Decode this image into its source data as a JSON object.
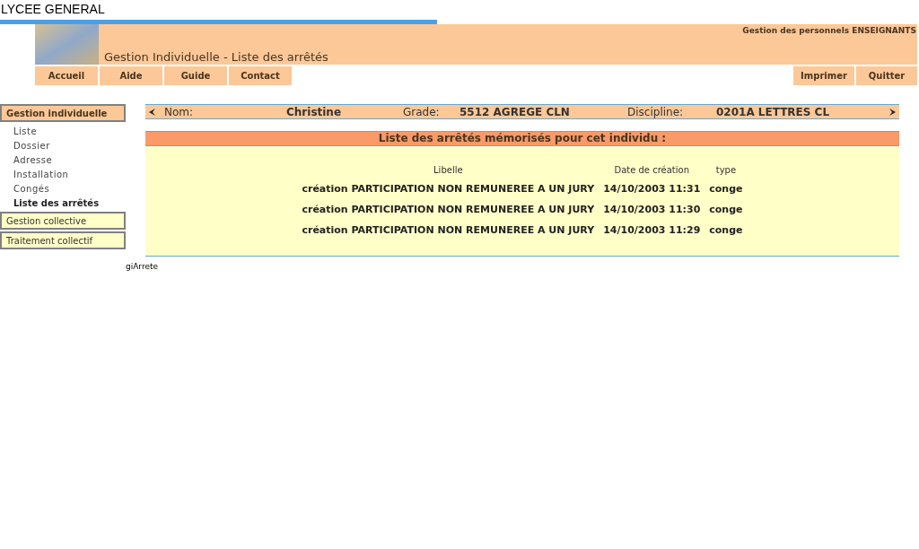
{
  "site_title": "LYCEE GENERAL",
  "banner": {
    "subtitle": "Gestion des personnels ENSEIGNANTS",
    "title": "Gestion Individuelle - Liste des arrêtés"
  },
  "nav_left": [
    "Accueil",
    "Aide",
    "Guide",
    "Contact"
  ],
  "nav_right": [
    "Imprimer",
    "Quitter"
  ],
  "sidebar": [
    {
      "label": "Gestion individuelle",
      "selected": true,
      "children": [
        {
          "label": "Liste",
          "selected": false
        },
        {
          "label": "Dossier",
          "selected": false
        },
        {
          "label": "Adresse",
          "selected": false
        },
        {
          "label": "Installation",
          "selected": false
        },
        {
          "label": "Congés",
          "selected": false
        },
        {
          "label": "Liste des arrêtés",
          "selected": true
        }
      ]
    },
    {
      "label": "Gestion collective",
      "selected": false
    },
    {
      "label": "Traitement collectif",
      "selected": false
    }
  ],
  "person": {
    "name_label": "Nom:",
    "name": "Christine",
    "grade_label": "Grade:",
    "grade": "5512 AGREGE CLN",
    "discipline_label": "Discipline:",
    "discipline": "0201A LETTRES CL"
  },
  "list": {
    "title": "Liste des arrêtés mémorisés pour cet individu :",
    "columns": [
      "Libelle",
      "Date de création",
      "type"
    ],
    "rows": [
      [
        "création PARTICIPATION NON REMUNEREE A UN JURY",
        "14/10/2003 11:31",
        "conge"
      ],
      [
        "création PARTICIPATION NON REMUNEREE A UN JURY",
        "14/10/2003 11:30",
        "conge"
      ],
      [
        "création PARTICIPATION NON REMUNEREE A UN JURY",
        "14/10/2003 11:29",
        "conge"
      ]
    ]
  },
  "footer_label": "giArrete"
}
